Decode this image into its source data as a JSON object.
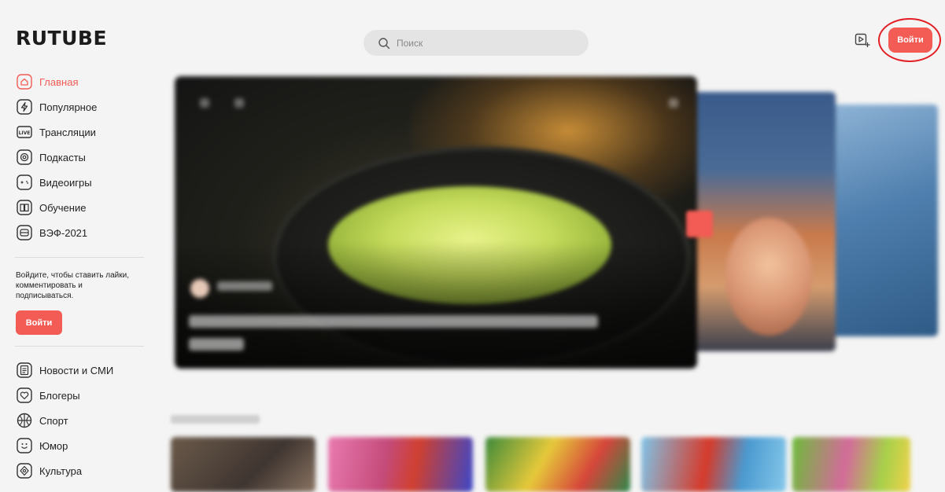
{
  "header": {
    "logo": "RUTUBE",
    "search_placeholder": "Поиск",
    "login_label": "Войти"
  },
  "sidebar": {
    "items": [
      {
        "label": "Главная",
        "icon": "home-icon",
        "active": true
      },
      {
        "label": "Популярное",
        "icon": "lightning-icon"
      },
      {
        "label": "Трансляции",
        "icon": "live-icon"
      },
      {
        "label": "Подкасты",
        "icon": "podcast-icon"
      },
      {
        "label": "Видеоигры",
        "icon": "gamepad-icon"
      },
      {
        "label": "Обучение",
        "icon": "book-icon"
      },
      {
        "label": "ВЭФ-2021",
        "icon": "vef-icon"
      }
    ],
    "login_prompt": "Войдите, чтобы ставить лайки, комментировать и подписываться.",
    "login_label": "Войти",
    "categories": [
      {
        "label": "Новости и СМИ",
        "icon": "news-icon"
      },
      {
        "label": "Блогеры",
        "icon": "heart-icon"
      },
      {
        "label": "Спорт",
        "icon": "ball-icon"
      },
      {
        "label": "Юмор",
        "icon": "smile-icon"
      },
      {
        "label": "Культура",
        "icon": "culture-icon"
      }
    ]
  },
  "colors": {
    "accent": "#f25c54",
    "highlight_ring": "#e31e24",
    "background": "#f4f4f4"
  }
}
